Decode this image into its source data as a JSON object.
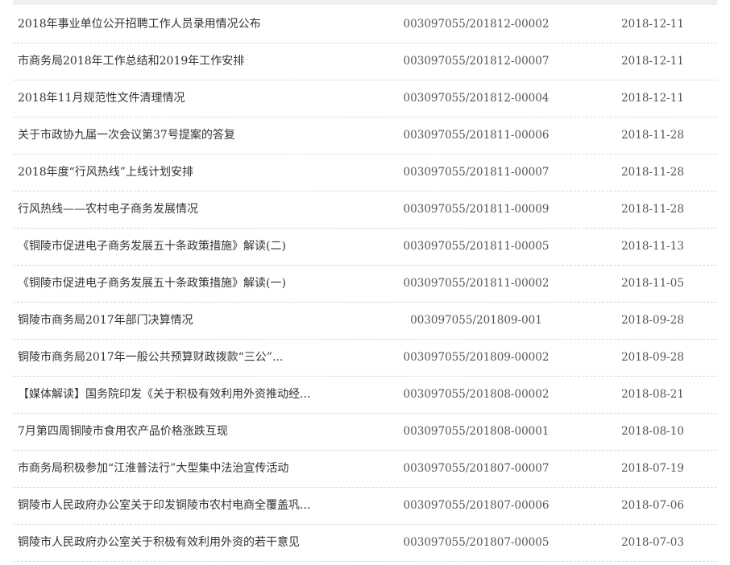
{
  "rows": [
    {
      "title": "2018年事业单位公开招聘工作人员录用情况公布",
      "code": "003097055/201812-00002",
      "date": "2018-12-11"
    },
    {
      "title": "市商务局2018年工作总结和2019年工作安排",
      "code": "003097055/201812-00007",
      "date": "2018-12-11"
    },
    {
      "title": "2018年11月规范性文件清理情况",
      "code": "003097055/201812-00004",
      "date": "2018-12-11"
    },
    {
      "title": "关于市政协九届一次会议第37号提案的答复",
      "code": "003097055/201811-00006",
      "date": "2018-11-28"
    },
    {
      "title": "2018年度“行风热线”上线计划安排",
      "code": "003097055/201811-00007",
      "date": "2018-11-28"
    },
    {
      "title": "行风热线——农村电子商务发展情况",
      "code": "003097055/201811-00009",
      "date": "2018-11-28"
    },
    {
      "title": "《铜陵市促进电子商务发展五十条政策措施》解读(二)",
      "code": "003097055/201811-00005",
      "date": "2018-11-13"
    },
    {
      "title": "《铜陵市促进电子商务发展五十条政策措施》解读(一)",
      "code": "003097055/201811-00002",
      "date": "2018-11-05"
    },
    {
      "title": "铜陵市商务局2017年部门决算情况",
      "code": "003097055/201809-001",
      "date": "2018-09-28"
    },
    {
      "title": "铜陵市商务局2017年一般公共预算财政拨款“三公”...",
      "code": "003097055/201809-00002",
      "date": "2018-09-28"
    },
    {
      "title": "【媒体解读】国务院印发《关于积极有效利用外资推动经...",
      "code": "003097055/201808-00002",
      "date": "2018-08-21"
    },
    {
      "title": "7月第四周铜陵市食用农产品价格涨跌互现",
      "code": "003097055/201808-00001",
      "date": "2018-08-10"
    },
    {
      "title": "市商务局积极参加“江淮普法行”大型集中法治宣传活动",
      "code": "003097055/201807-00007",
      "date": "2018-07-19"
    },
    {
      "title": "铜陵市人民政府办公室关于印发铜陵市农村电商全覆盖巩...",
      "code": "003097055/201807-00006",
      "date": "2018-07-06"
    },
    {
      "title": "铜陵市人民政府办公室关于积极有效利用外资的若干意见",
      "code": "003097055/201807-00005",
      "date": "2018-07-03"
    }
  ]
}
